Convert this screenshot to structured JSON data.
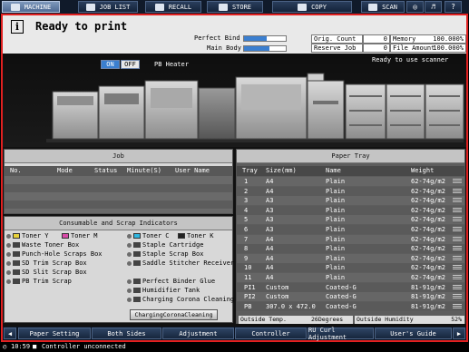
{
  "tabs": {
    "machine": "MACHINE",
    "job_list": "JOB LIST",
    "recall": "RECALL",
    "store": "STORE",
    "copy": "COPY",
    "scan": "SCAN"
  },
  "status": {
    "title": "Ready to print",
    "perfect_bind_label": "Perfect Bind",
    "main_body_label": "Main Body",
    "perfect_bind_level": 0.55,
    "main_body_level": 0.6,
    "scanner_status": "Ready to use scanner"
  },
  "counters": {
    "orig_count_label": "Orig. Count",
    "orig_count_value": "0",
    "memory_label": "Memory",
    "memory_value": "100.000%",
    "reserve_job_label": "Reserve Job",
    "reserve_job_value": "0",
    "file_amount_label": "File Amount",
    "file_amount_value": "100.000%"
  },
  "heater": {
    "on_label": "ON",
    "off_label": "OFF",
    "label": "PB Heater"
  },
  "job": {
    "title": "Job",
    "columns": [
      "No.",
      "Mode",
      "Status",
      "Minute(S)",
      "User Name"
    ]
  },
  "consumables": {
    "title": "Consumable and Scrap Indicators",
    "items_left": [
      "Toner Y",
      "Toner M",
      "Waste Toner Box",
      "Punch-Hole Scraps Box",
      "SD Trim Scrap Box",
      "SD Slit Scrap Box",
      "PB Trim Scrap"
    ],
    "items_right": [
      "Toner C",
      "Toner K",
      "Staple Cartridge",
      "Staple Scrap Box",
      "Saddle Stitcher Receiver",
      "Perfect Binder Glue",
      "Humidifier Tank",
      "Charging Corona Cleaning"
    ],
    "button_label": "ChargingCoronaCleaning"
  },
  "paper_tray": {
    "title": "Paper Tray",
    "columns": [
      "Tray",
      "Size(mm)",
      "Name",
      "Weight"
    ],
    "rows": [
      {
        "tray": "1",
        "size": "A4",
        "name": "Plain",
        "weight": "62-74g/m2"
      },
      {
        "tray": "2",
        "size": "A4",
        "name": "Plain",
        "weight": "62-74g/m2"
      },
      {
        "tray": "3",
        "size": "A3",
        "name": "Plain",
        "weight": "62-74g/m2"
      },
      {
        "tray": "4",
        "size": "A3",
        "name": "Plain",
        "weight": "62-74g/m2"
      },
      {
        "tray": "5",
        "size": "A3",
        "name": "Plain",
        "weight": "62-74g/m2"
      },
      {
        "tray": "6",
        "size": "A3",
        "name": "Plain",
        "weight": "62-74g/m2"
      },
      {
        "tray": "7",
        "size": "A4",
        "name": "Plain",
        "weight": "62-74g/m2"
      },
      {
        "tray": "8",
        "size": "A4",
        "name": "Plain",
        "weight": "62-74g/m2"
      },
      {
        "tray": "9",
        "size": "A4",
        "name": "Plain",
        "weight": "62-74g/m2"
      },
      {
        "tray": "10",
        "size": "A4",
        "name": "Plain",
        "weight": "62-74g/m2"
      },
      {
        "tray": "11",
        "size": "A4",
        "name": "Plain",
        "weight": "62-74g/m2"
      },
      {
        "tray": "PI1",
        "size": "Custom",
        "name": "Coated-G",
        "weight": "81-91g/m2"
      },
      {
        "tray": "PI2",
        "size": "Custom",
        "name": "Coated-G",
        "weight": "81-91g/m2"
      },
      {
        "tray": "PB",
        "size": "307.0 x 472.0",
        "name": "Coated-G",
        "weight": "81-91g/m2"
      }
    ],
    "outside_temp_label": "Outside Temp.",
    "outside_temp_value": "26Degrees",
    "outside_humidity_label": "Outside Humidity",
    "outside_humidity_value": "52%"
  },
  "bottom_tabs": [
    "Paper Setting",
    "Both Sides",
    "Adjustment",
    "Controller",
    "RU Curl Adjustment",
    "User's Guide"
  ],
  "footer": {
    "time": "10:59",
    "message": "Controller unconnected"
  },
  "colors": {
    "frame": "#e02020",
    "accent": "#3b7fd0",
    "tab_active": "#6f89ae"
  }
}
